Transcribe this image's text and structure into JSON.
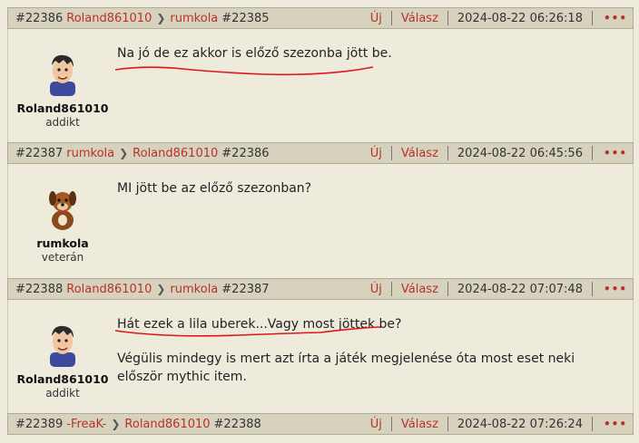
{
  "posts": [
    {
      "id": "#22386",
      "author": "Roland861010",
      "reply_to": "rumkola",
      "reply_id": "#22385",
      "new_label": "Új",
      "reply_label": "Válasz",
      "date": "2024-08-22 06:26:18",
      "menu": "•••",
      "author_name": "Roland861010",
      "author_rank": "addikt",
      "paragraphs": [
        "Na jó de ez akkor is előző szezonba jött be."
      ],
      "avatar": "boy-avatar-icon"
    },
    {
      "id": "#22387",
      "author": "rumkola",
      "reply_to": "Roland861010",
      "reply_id": "#22386",
      "new_label": "Új",
      "reply_label": "Válasz",
      "date": "2024-08-22 06:45:56",
      "menu": "•••",
      "author_name": "rumkola",
      "author_rank": "veterán",
      "paragraphs": [
        "MI jött be az előző szezonban?"
      ],
      "avatar": "dog-avatar-icon"
    },
    {
      "id": "#22388",
      "author": "Roland861010",
      "reply_to": "rumkola",
      "reply_id": "#22387",
      "new_label": "Új",
      "reply_label": "Válasz",
      "date": "2024-08-22 07:07:48",
      "menu": "•••",
      "author_name": "Roland861010",
      "author_rank": "addikt",
      "paragraphs": [
        "Hát ezek a lila uberek...Vagy most jöttek be?",
        "Végülis mindegy is mert azt írta a játék megjelenése óta most eset neki először mythic item."
      ],
      "avatar": "boy-avatar-icon"
    },
    {
      "id": "#22389",
      "author": "-FreaK-",
      "reply_to": "Roland861010",
      "reply_id": "#22388",
      "new_label": "Új",
      "reply_label": "Válasz",
      "date": "2024-08-22 07:26:24",
      "menu": "•••"
    }
  ],
  "colors": {
    "accent": "#b8322b",
    "header_bg": "#d7d2bd",
    "body_bg": "#eeebdd",
    "annotation": "#e0151b"
  }
}
